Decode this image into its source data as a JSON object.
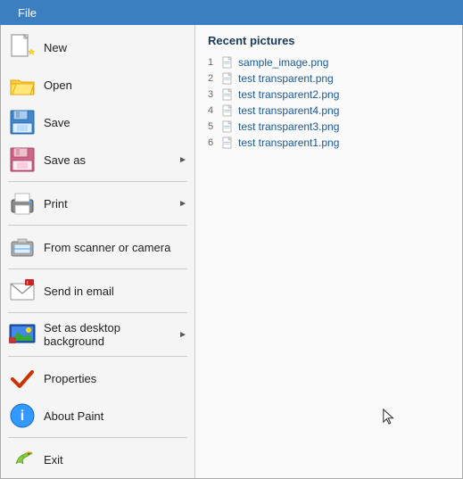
{
  "menubar": {
    "tab_label": "File"
  },
  "left_menu": {
    "items": [
      {
        "id": "new",
        "label": "New",
        "has_arrow": false,
        "has_divider": false
      },
      {
        "id": "open",
        "label": "Open",
        "has_arrow": false,
        "has_divider": false
      },
      {
        "id": "save",
        "label": "Save",
        "has_arrow": false,
        "has_divider": false
      },
      {
        "id": "save-as",
        "label": "Save as",
        "has_arrow": true,
        "has_divider": false
      },
      {
        "id": "print",
        "label": "Print",
        "has_arrow": true,
        "has_divider": false
      },
      {
        "id": "from-scanner",
        "label": "From scanner or camera",
        "has_arrow": false,
        "has_divider": false
      },
      {
        "id": "send-email",
        "label": "Send in email",
        "has_arrow": false,
        "has_divider": false
      },
      {
        "id": "set-desktop",
        "label": "Set as desktop background",
        "has_arrow": true,
        "has_divider": false
      },
      {
        "id": "properties",
        "label": "Properties",
        "has_arrow": false,
        "has_divider": false
      },
      {
        "id": "about",
        "label": "About Paint",
        "has_arrow": false,
        "has_divider": false
      },
      {
        "id": "exit",
        "label": "Exit",
        "has_arrow": false,
        "has_divider": false
      }
    ]
  },
  "right_panel": {
    "title": "Recent pictures",
    "recent_files": [
      {
        "num": "1",
        "name": "sample_image.png"
      },
      {
        "num": "2",
        "name": "test transparent.png"
      },
      {
        "num": "3",
        "name": "test transparent2.png"
      },
      {
        "num": "4",
        "name": "test transparent4.png"
      },
      {
        "num": "5",
        "name": "test transparent3.png"
      },
      {
        "num": "6",
        "name": "test transparent1.png"
      }
    ]
  }
}
